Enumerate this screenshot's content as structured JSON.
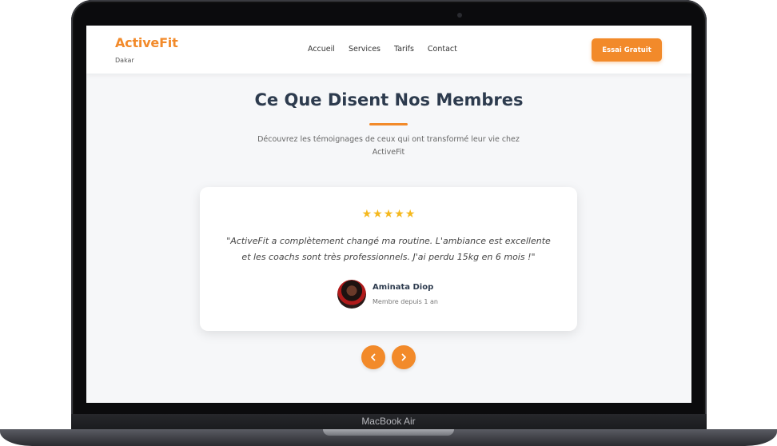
{
  "device": {
    "label": "MacBook Air"
  },
  "header": {
    "brand": "ActiveFit",
    "brand_sub": "Dakar",
    "nav": [
      "Accueil",
      "Services",
      "Tarifs",
      "Contact"
    ],
    "cta": "Essai Gratuit"
  },
  "section": {
    "title": "Ce Que Disent Nos Membres",
    "subtitle": "Découvrez les témoignages de ceux qui ont transformé leur vie chez ActiveFit"
  },
  "testimonial": {
    "rating": 5,
    "quote": "\"ActiveFit a complètement changé ma routine. L'ambiance est excellente et les coachs sont très professionnels. J'ai perdu 15kg en 6 mois !\"",
    "author_name": "Aminata Diop",
    "author_meta": "Membre depuis 1 an"
  },
  "colors": {
    "accent": "#f28a2a",
    "heading": "#2d3b4e",
    "star": "#f5b81d"
  },
  "icons": {
    "prev": "chevron-left-icon",
    "next": "chevron-right-icon",
    "star": "star-icon"
  }
}
